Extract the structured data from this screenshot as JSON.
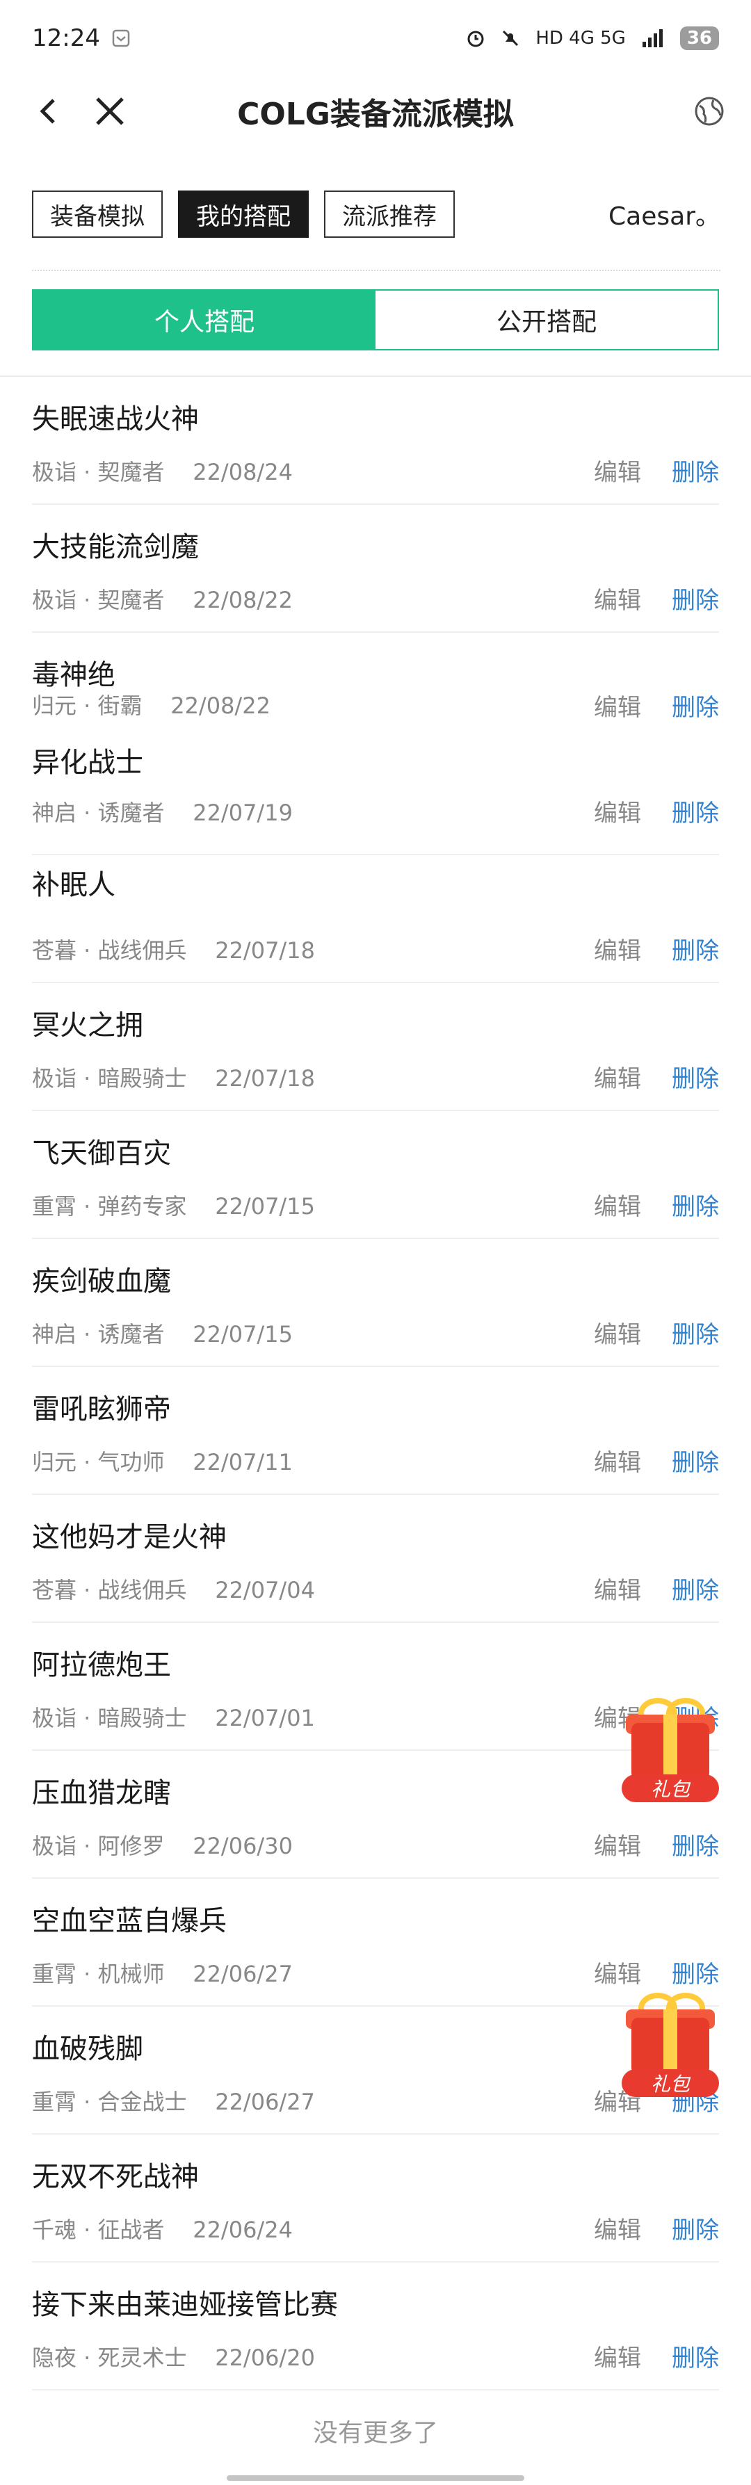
{
  "status": {
    "time": "12:24",
    "network": "HD 4G 5G",
    "battery": "36"
  },
  "header": {
    "title": "COLG装备流派模拟"
  },
  "top_tabs": [
    "装备模拟",
    "我的搭配",
    "流派推荐"
  ],
  "user_name": "Caesar。",
  "segment": [
    "个人搭配",
    "公开搭配"
  ],
  "actions": {
    "edit": "编辑",
    "delete": "删除"
  },
  "builds": [
    {
      "name": "失眠速战火神",
      "meta": "极诣 · 契魔者    22/08/24"
    },
    {
      "name": "大技能流剑魔",
      "meta": "极诣 · 契魔者    22/08/22"
    },
    {
      "name": "毒神绝",
      "meta": "归元 · 街霸    22/08/22"
    },
    {
      "name": "异化战士",
      "meta": "神启 · 诱魔者    22/07/19"
    },
    {
      "name": "补眠人",
      "meta": "苍暮 · 战线佣兵    22/07/18"
    },
    {
      "name": "冥火之拥",
      "meta": "极诣 · 暗殿骑士    22/07/18"
    },
    {
      "name": "飞天御百灾",
      "meta": "重霄 · 弹药专家    22/07/15"
    },
    {
      "name": "疾剑破血魔",
      "meta": "神启 · 诱魔者    22/07/15"
    },
    {
      "name": "雷吼眩狮帝",
      "meta": "归元 · 气功师    22/07/11"
    },
    {
      "name": "这他妈才是火神",
      "meta": "苍暮 · 战线佣兵    22/07/04"
    },
    {
      "name": "阿拉德炮王",
      "meta": "极诣 · 暗殿骑士    22/07/01"
    },
    {
      "name": "压血猎龙瞎",
      "meta": "极诣 · 阿修罗    22/06/30"
    },
    {
      "name": "空血空蓝自爆兵",
      "meta": "重霄 · 机械师    22/06/27"
    },
    {
      "name": "血破残脚",
      "meta": "重霄 · 合金战士    22/06/27"
    },
    {
      "name": "无双不死战神",
      "meta": "千魂 · 征战者    22/06/24"
    },
    {
      "name": "接下来由莱迪娅接管比赛",
      "meta": "隐夜 · 死灵术士    22/06/20"
    }
  ],
  "gift_label": "礼包",
  "footer": "没有更多了",
  "colors": {
    "accent": "#1fc18b",
    "link": "#2f82d4",
    "gift": "#e63a2b"
  }
}
